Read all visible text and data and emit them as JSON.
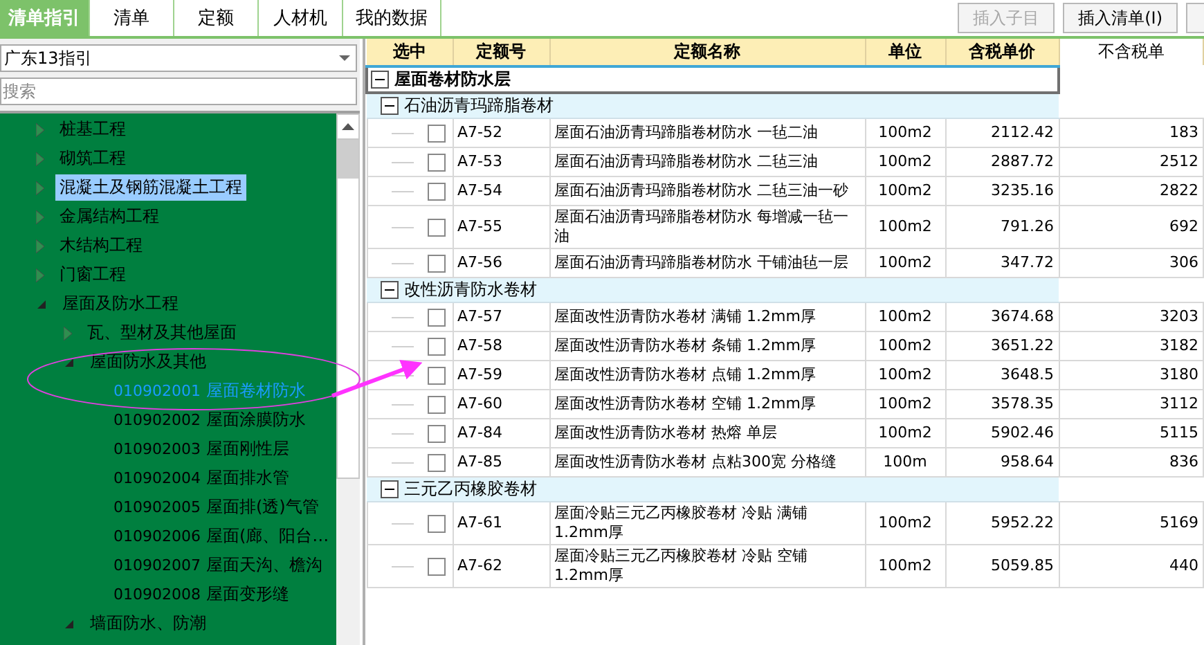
{
  "tabs": [
    {
      "label": "清单指引",
      "selected": true
    },
    {
      "label": "清单",
      "selected": false
    },
    {
      "label": "定额",
      "selected": false
    },
    {
      "label": "人材机",
      "selected": false
    },
    {
      "label": "我的数据",
      "selected": false
    }
  ],
  "toolbar": {
    "buttons": [
      {
        "label": "插入子目",
        "disabled": true
      },
      {
        "label": "插入清单(I)",
        "disabled": false
      }
    ]
  },
  "guide_select": {
    "value": "广东13指引"
  },
  "search": {
    "placeholder": "搜索"
  },
  "tree": {
    "items": [
      {
        "label": "桩基工程",
        "expanded": false,
        "selected": false
      },
      {
        "label": "砌筑工程",
        "expanded": false,
        "selected": false
      },
      {
        "label": "混凝土及钢筋混凝土工程",
        "expanded": false,
        "selected": true
      },
      {
        "label": "金属结构工程",
        "expanded": false,
        "selected": false
      },
      {
        "label": "木结构工程",
        "expanded": false,
        "selected": false
      },
      {
        "label": "门窗工程",
        "expanded": false,
        "selected": false
      },
      {
        "label": "屋面及防水工程",
        "expanded": true,
        "selected": false,
        "children": [
          {
            "label": "瓦、型材及其他屋面",
            "expanded": false,
            "selected": false
          },
          {
            "label": "屋面防水及其他",
            "expanded": true,
            "selected": false,
            "children": [
              {
                "code": "010902001",
                "label": "屋面卷材防水",
                "selected": false,
                "highlighted": true
              },
              {
                "code": "010902002",
                "label": "屋面涂膜防水",
                "selected": false,
                "highlighted": false
              },
              {
                "code": "010902003",
                "label": "屋面刚性层",
                "selected": false,
                "highlighted": false
              },
              {
                "code": "010902004",
                "label": "屋面排水管",
                "selected": false,
                "highlighted": false
              },
              {
                "code": "010902005",
                "label": "屋面排(透)气管",
                "selected": false,
                "highlighted": false
              },
              {
                "code": "010902006",
                "label": "屋面(廊、阳台…",
                "selected": false,
                "highlighted": false
              },
              {
                "code": "010902007",
                "label": "屋面天沟、檐沟",
                "selected": false,
                "highlighted": false
              },
              {
                "code": "010902008",
                "label": "屋面变形缝",
                "selected": false,
                "highlighted": false
              }
            ]
          },
          {
            "label": "墙面防水、防潮",
            "expanded": true,
            "selected": false
          }
        ]
      }
    ]
  },
  "table": {
    "columns": [
      "选中",
      "定额号",
      "定额名称",
      "单位",
      "含税单价",
      "不含税单"
    ],
    "groups": [
      {
        "title": "屋面卷材防水层",
        "expanded": true,
        "subgroups": [
          {
            "title": "石油沥青玛蹄脂卷材",
            "expanded": true,
            "rows": [
              {
                "checked": false,
                "code": "A7-52",
                "name": "屋面石油沥青玛蹄脂卷材防水 一毡二油",
                "unit": "100m2",
                "price": "2112.42",
                "price_ex_tax": "183"
              },
              {
                "checked": false,
                "code": "A7-53",
                "name": "屋面石油沥青玛蹄脂卷材防水 二毡三油",
                "unit": "100m2",
                "price": "2887.72",
                "price_ex_tax": "2512"
              },
              {
                "checked": false,
                "code": "A7-54",
                "name": "屋面石油沥青玛蹄脂卷材防水 二毡三油一砂",
                "unit": "100m2",
                "price": "3235.16",
                "price_ex_tax": "2822"
              },
              {
                "checked": false,
                "code": "A7-55",
                "name": "屋面石油沥青玛蹄脂卷材防水 每增减一毡一油",
                "unit": "100m2",
                "price": "791.26",
                "price_ex_tax": "692"
              },
              {
                "checked": false,
                "code": "A7-56",
                "name": "屋面石油沥青玛蹄脂卷材防水 干铺油毡一层",
                "unit": "100m2",
                "price": "347.72",
                "price_ex_tax": "306"
              }
            ]
          },
          {
            "title": "改性沥青防水卷材",
            "expanded": true,
            "rows": [
              {
                "checked": false,
                "code": "A7-57",
                "name": "屋面改性沥青防水卷材 满铺 1.2mm厚",
                "unit": "100m2",
                "price": "3674.68",
                "price_ex_tax": "3203"
              },
              {
                "checked": false,
                "code": "A7-58",
                "name": "屋面改性沥青防水卷材 条铺 1.2mm厚",
                "unit": "100m2",
                "price": "3651.22",
                "price_ex_tax": "3182"
              },
              {
                "checked": false,
                "code": "A7-59",
                "name": "屋面改性沥青防水卷材 点铺 1.2mm厚",
                "unit": "100m2",
                "price": "3648.5",
                "price_ex_tax": "3180"
              },
              {
                "checked": false,
                "code": "A7-60",
                "name": "屋面改性沥青防水卷材 空铺 1.2mm厚",
                "unit": "100m2",
                "price": "3578.35",
                "price_ex_tax": "3112"
              },
              {
                "checked": false,
                "code": "A7-84",
                "name": "屋面改性沥青防水卷材 热熔 单层",
                "unit": "100m2",
                "price": "5902.46",
                "price_ex_tax": "5115"
              },
              {
                "checked": false,
                "code": "A7-85",
                "name": "屋面改性沥青防水卷材 点粘300宽 分格缝",
                "unit": "100m",
                "price": "958.64",
                "price_ex_tax": "836"
              }
            ]
          },
          {
            "title": "三元乙丙橡胶卷材",
            "expanded": true,
            "rows": [
              {
                "checked": false,
                "code": "A7-61",
                "name": "屋面冷贴三元乙丙橡胶卷材 冷贴 满铺 1.2mm厚",
                "unit": "100m2",
                "price": "5952.22",
                "price_ex_tax": "5169"
              },
              {
                "checked": false,
                "code": "A7-62",
                "name": "屋面冷贴三元乙丙橡胶卷材 冷贴 空铺 1.2mm厚",
                "unit": "100m2",
                "price": "5059.85",
                "price_ex_tax": "440"
              }
            ]
          }
        ]
      }
    ]
  }
}
